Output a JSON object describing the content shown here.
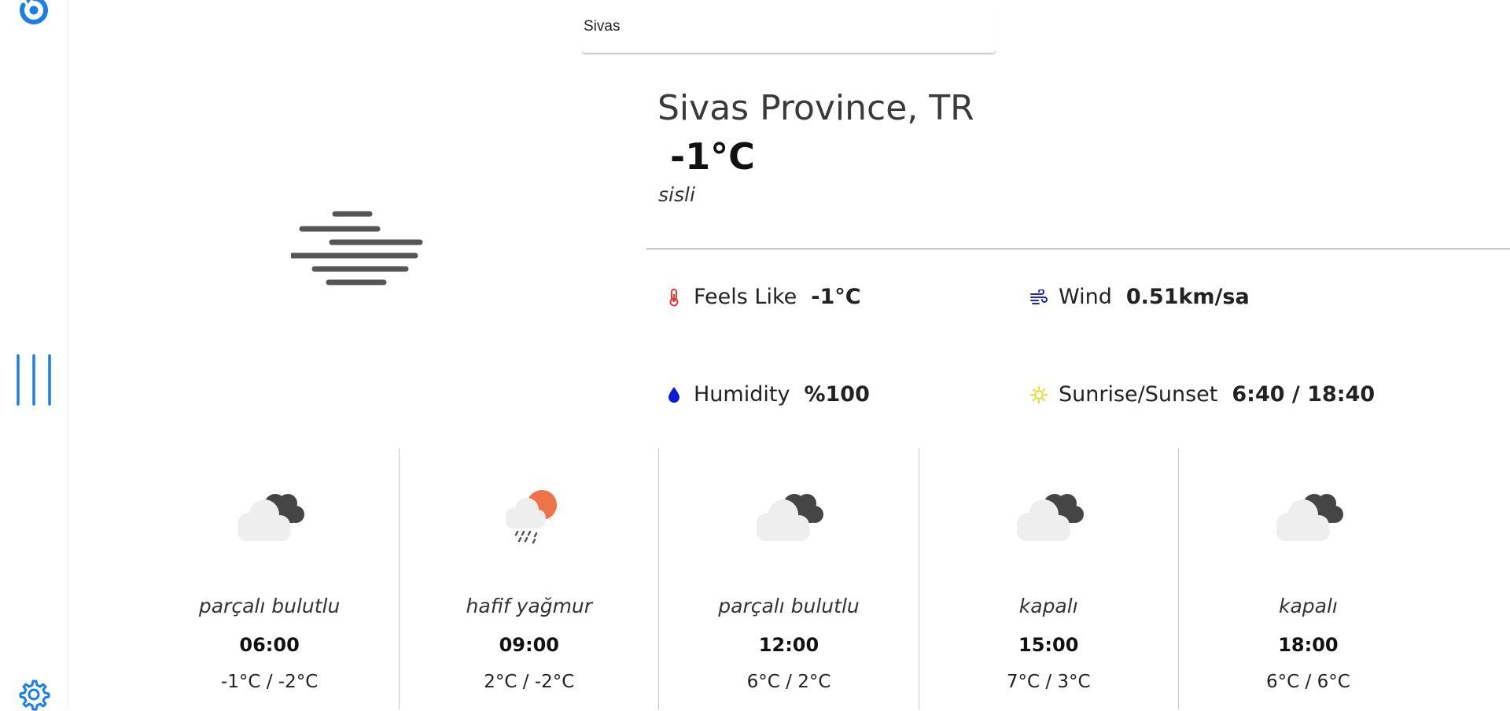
{
  "search": {
    "value": "Sivas"
  },
  "current": {
    "location": "Sivas Province, TR",
    "temperature": "-1°C",
    "description": "sisli",
    "icon": "fog-icon"
  },
  "details": {
    "feels_like": {
      "label": "Feels Like",
      "value": "-1°C",
      "icon": "thermometer-icon",
      "color": "#e53935"
    },
    "wind": {
      "label": "Wind",
      "value": "0.51km/sa",
      "icon": "wind-icon",
      "color": "#1a23d8"
    },
    "humidity": {
      "label": "Humidity",
      "value": "%100",
      "icon": "water-drop-icon",
      "color": "#0b1bd6"
    },
    "sunrise_sunset": {
      "label": "Sunrise/Sunset",
      "value": "6:40 / 18:40",
      "icon": "sun-icon",
      "color": "#f3e52a"
    }
  },
  "forecast": [
    {
      "description": "parçalı bulutlu",
      "time": "06:00",
      "range": "-1°C / -2°C",
      "icon": "broken-clouds-icon"
    },
    {
      "description": "hafif yağmur",
      "time": "09:00",
      "range": "2°C / -2°C",
      "icon": "light-rain-icon"
    },
    {
      "description": "parçalı bulutlu",
      "time": "12:00",
      "range": "6°C / 2°C",
      "icon": "broken-clouds-icon"
    },
    {
      "description": "kapalı",
      "time": "15:00",
      "range": "7°C / 3°C",
      "icon": "overcast-clouds-icon"
    },
    {
      "description": "kapalı",
      "time": "18:00",
      "range": "6°C / 6°C",
      "icon": "overcast-clouds-icon"
    }
  ],
  "colors": {
    "accent": "#1a7fe8",
    "sun": "#ee7348",
    "cloud_light": "#eeeeee",
    "cloud_dark": "#454545",
    "fog": "#555555"
  }
}
